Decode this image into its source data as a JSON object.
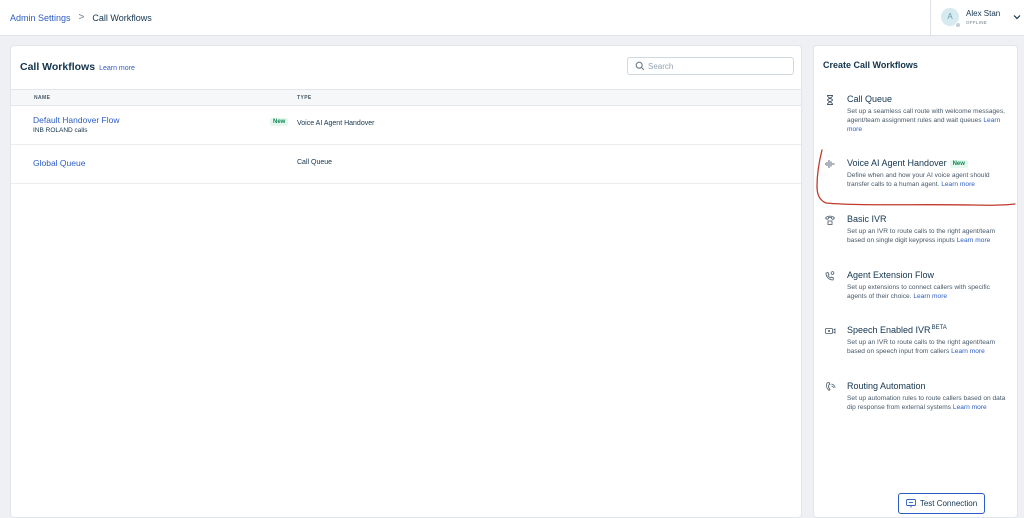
{
  "breadcrumb": {
    "parent": "Admin Settings",
    "separator": ">",
    "current": "Call Workflows"
  },
  "user": {
    "initial": "A",
    "name": "Alex Stan",
    "status": "OFFLINE"
  },
  "main": {
    "title": "Call Workflows",
    "learn_more": "Learn more",
    "search": {
      "placeholder": "Search",
      "value": ""
    },
    "columns": {
      "name": "NAME",
      "type": "TYPE"
    },
    "rows": [
      {
        "name": "Default Handover Flow",
        "subtitle": "INB ROLAND calls",
        "badge": "New",
        "type": "Voice AI Agent Handover"
      },
      {
        "name": "Global Queue",
        "type": "Call Queue"
      }
    ]
  },
  "sidebar": {
    "title": "Create Call Workflows",
    "items": [
      {
        "icon": "hourglass-icon",
        "title": "Call Queue",
        "desc": "Set up a seamless call route with welcome messages, agent/team assignment rules and wait queues",
        "link": "Learn more"
      },
      {
        "icon": "voice-wave-icon",
        "title": "Voice AI Agent Handover",
        "tag": "New",
        "desc": "Define when and how your AI voice agent should transfer calls to a human agent.",
        "link": "Learn more"
      },
      {
        "icon": "ivr-phone-icon",
        "title": "Basic IVR",
        "desc": "Set up an IVR to route calls to the right agent/team based on single digit keypress inputs",
        "link": "Learn more"
      },
      {
        "icon": "extension-phone-icon",
        "title": "Agent Extension Flow",
        "desc": "Set up extensions to connect callers with specific agents of their choice.",
        "link": "Learn more"
      },
      {
        "icon": "speech-ivr-icon",
        "title": "Speech Enabled IVR",
        "tag": "BETA",
        "desc": "Set up an IVR to route calls to the right agent/team based on speech input from callers",
        "link": "Learn more"
      },
      {
        "icon": "routing-phone-icon",
        "title": "Routing Automation",
        "desc": "Set up automation rules to route callers based on data dip response from external systems",
        "link": "Learn more"
      }
    ]
  },
  "footer": {
    "test_connection": "Test Connection"
  },
  "colors": {
    "link": "#2c5cc5",
    "text": "#12344d",
    "annotation": "#c0392b"
  }
}
